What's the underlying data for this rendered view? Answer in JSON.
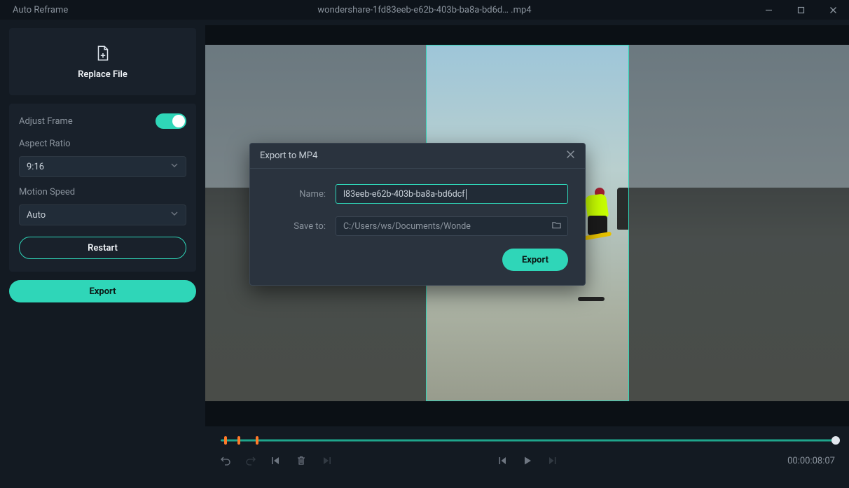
{
  "titlebar": {
    "app_title": "Auto Reframe",
    "file_name": "wondershare-1fd83eeb-e62b-403b-ba8a-bd6d… .mp4"
  },
  "sidebar": {
    "replace_label": "Replace File",
    "adjust_frame_label": "Adjust Frame",
    "adjust_frame_on": true,
    "aspect_ratio_label": "Aspect Ratio",
    "aspect_ratio_value": "9:16",
    "motion_speed_label": "Motion Speed",
    "motion_speed_value": "Auto",
    "restart_label": "Restart",
    "export_label": "Export"
  },
  "timeline": {
    "current_time": "00:00:08:07",
    "markers_pct": [
      1.0,
      3.2,
      6.1
    ],
    "playhead_pct": 99.2
  },
  "dialog": {
    "title": "Export to MP4",
    "name_label": "Name:",
    "name_value": "l83eeb-e62b-403b-ba8a-bd6dcf",
    "saveto_label": "Save to:",
    "saveto_value": "C:/Users/ws/Documents/Wonde",
    "export_label": "Export"
  }
}
